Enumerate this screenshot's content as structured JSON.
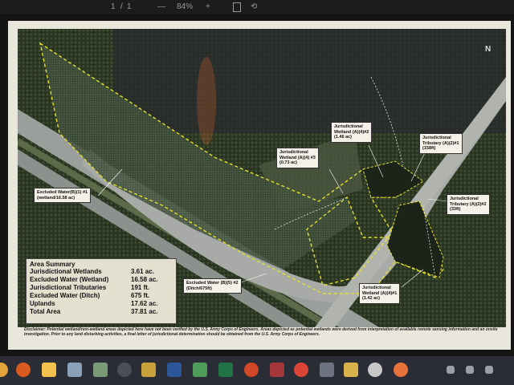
{
  "toolbar": {
    "page_current": "1",
    "page_sep": "/",
    "page_total": "1",
    "zoom_out": "—",
    "zoom": "84%",
    "zoom_in": "+"
  },
  "map": {
    "north": "N",
    "labels": {
      "excluded_b1": "Excluded Water(B)(1) #1\n(wetland/16.58 ac)",
      "jw_a4_3": "Jurisdictional\nWetland (A)(4) #3\n(0.73 ac)",
      "jw_a4_2": "Jurisdictional\nWetland (A)(4)#2\n(1.46 ac)",
      "jt_a2_1": "Jurisdictional\nTributary (A)(2)#1\n(158ft)",
      "jt_a2_2": "Jurisdictional\nTributary (A)(2)#2\n(33ft)",
      "excluded_b5": "Excluded Water (B)(5) #2\n(Ditch/675ft)",
      "jw_a4_1": "Jurisdictional\nWetland (A)(4)#1\n(1.42 ac)"
    }
  },
  "summary": {
    "title": "Area Summary",
    "rows": [
      {
        "name": "Jurisdictional Wetlands",
        "value": "3.61 ac."
      },
      {
        "name": "Excluded Water (Wetland)",
        "value": "16.58 ac."
      },
      {
        "name": "Jurisdictional Tributaries",
        "value": "191 ft."
      },
      {
        "name": "Excluded Water (Ditch)",
        "value": "675 ft."
      },
      {
        "name": "Uplands",
        "value": "17.62 ac."
      },
      {
        "name": "Total Area",
        "value": "37.81 ac."
      }
    ]
  },
  "disclaimer": "Disclaimer: Potential wetland/non-wetland areas depicted here have not been verified by the U.S. Army Corps of Engineers. Areas depicted as potential wetlands were derived from interpretation of available remote sensing information and an onsite investigation. Prior to any land disturbing activities, a final letter of jurisdictional determination should be obtained from the U.S. Army Corps of Engineers.",
  "taskbar": {
    "icons": [
      "start-icon",
      "search-icon",
      "task-view-icon",
      "file-explorer-icon",
      "photos-icon",
      "mail-icon",
      "settings-icon",
      "calculator-icon",
      "word-icon",
      "excel-icon",
      "powerpoint-icon",
      "access-icon",
      "edge-icon",
      "chrome-icon",
      "camera-icon",
      "notes-icon",
      "media-icon",
      "firefox-icon"
    ],
    "colors": {
      "word": "#2b579a",
      "excel": "#217346",
      "powerpoint": "#d24726",
      "access": "#a4373a",
      "chrome": "#db4437"
    }
  }
}
